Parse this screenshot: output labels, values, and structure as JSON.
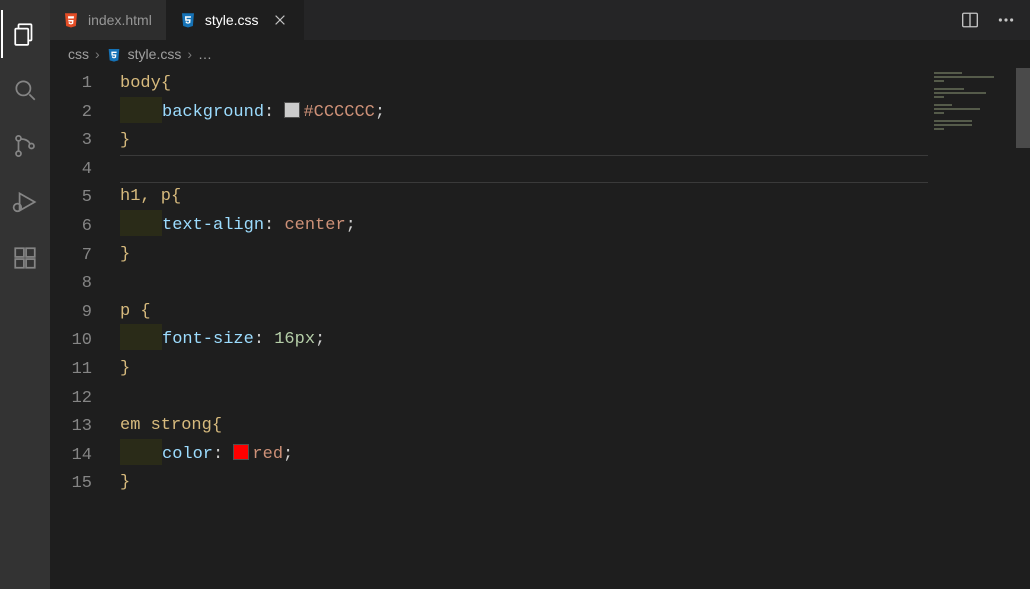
{
  "activity_bar": {
    "items": [
      "explorer",
      "search",
      "source-control",
      "run-debug",
      "extensions"
    ],
    "active_index": 0
  },
  "tabs": [
    {
      "label": "index.html",
      "icon": "html5",
      "active": false
    },
    {
      "label": "style.css",
      "icon": "css3",
      "active": true
    }
  ],
  "title_actions": [
    "split-editor",
    "more"
  ],
  "breadcrumbs": {
    "segments": [
      "css",
      "style.css",
      "…"
    ],
    "file_icon": "css3"
  },
  "editor": {
    "line_count": 15,
    "current_line": 4,
    "lines": [
      {
        "kind": "selector-open",
        "selector": "body"
      },
      {
        "kind": "decl",
        "prop": "background",
        "value_color_swatch": "#CCCCCC",
        "value_text": "#CCCCCC"
      },
      {
        "kind": "close"
      },
      {
        "kind": "blank"
      },
      {
        "kind": "selector-open",
        "selector": "h1, p"
      },
      {
        "kind": "decl",
        "prop": "text-align",
        "value_text": "center"
      },
      {
        "kind": "close"
      },
      {
        "kind": "blank"
      },
      {
        "kind": "selector-open",
        "selector": "p "
      },
      {
        "kind": "decl",
        "prop": "font-size",
        "value_num": "16",
        "value_unit": "px"
      },
      {
        "kind": "close"
      },
      {
        "kind": "blank"
      },
      {
        "kind": "selector-open",
        "selector": "em strong"
      },
      {
        "kind": "decl",
        "prop": "color",
        "value_color_swatch": "#ff0000",
        "value_text": "red"
      },
      {
        "kind": "close"
      }
    ]
  }
}
